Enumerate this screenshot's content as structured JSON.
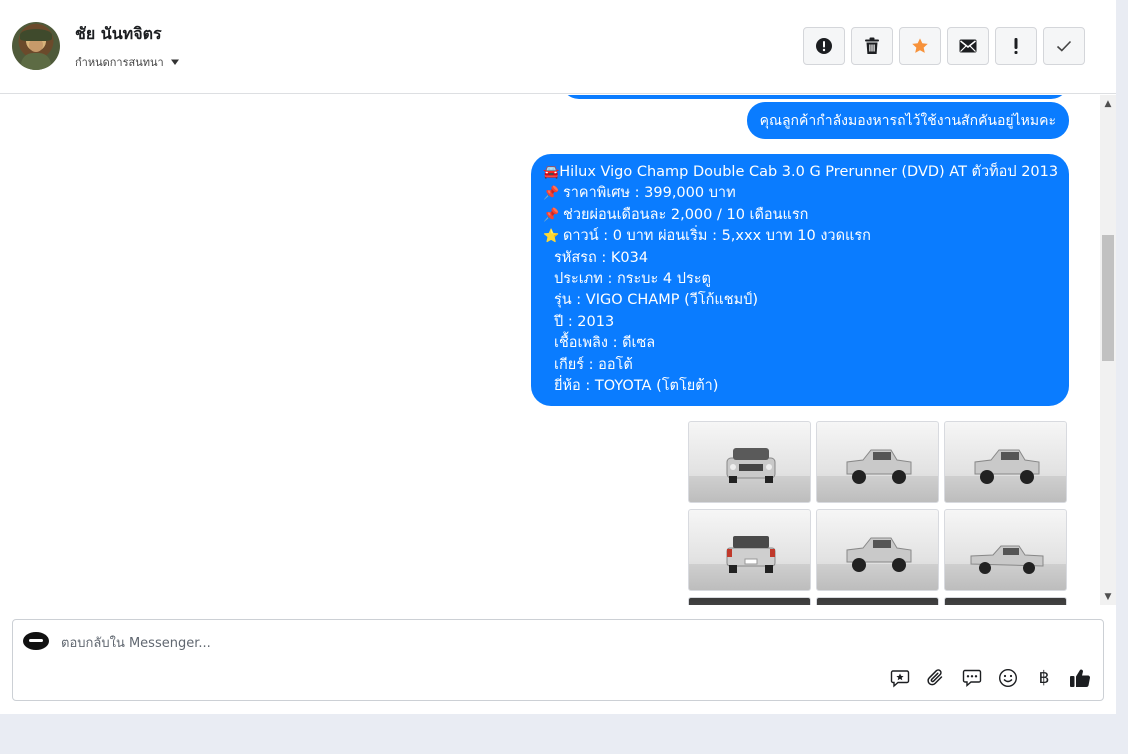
{
  "header": {
    "contact_name": "ชัย นันทจิตร",
    "assign_label": "กำหนดการสนทนา",
    "actions": [
      {
        "name": "spam-button",
        "icon": "alert-circle-icon"
      },
      {
        "name": "delete-button",
        "icon": "trash-icon"
      },
      {
        "name": "star-button",
        "icon": "star-icon",
        "color": "#f7923b"
      },
      {
        "name": "mark-unread-button",
        "icon": "envelope-icon"
      },
      {
        "name": "follow-up-button",
        "icon": "exclamation-icon"
      },
      {
        "name": "mark-done-button",
        "icon": "check-icon"
      }
    ]
  },
  "conversation": {
    "bubble_color": "#0a7cff",
    "question": "คุณลูกค้ากำลังมองหารถไว้ใช้งานสักคันอยู่ไหมคะ",
    "details": [
      {
        "emoji": "🚘",
        "text": "Hilux Vigo Champ Double Cab 3.0 G Prerunner (DVD) AT ตัวท็อป  2013"
      },
      {
        "emoji": "📌",
        "text": "ราคาพิเศษ : 399,000 บาท"
      },
      {
        "emoji": "📌",
        "text": "ช่วยผ่อนเดือนละ 2,000 / 10 เดือนแรก"
      },
      {
        "emoji": "⭐",
        "text": "ดาวน์ : 0 บาท ผ่อนเริ่ม : 5,xxx บาท 10 งวดแรก"
      },
      {
        "emoji": "",
        "text": "รหัสรถ : K034"
      },
      {
        "emoji": "",
        "text": "ประเภท : กระบะ 4 ประตู"
      },
      {
        "emoji": "",
        "text": "รุ่น : VIGO CHAMP (วีโก้แชมป์)"
      },
      {
        "emoji": "",
        "text": "ปี : 2013"
      },
      {
        "emoji": "",
        "text": "เชื้อเพลิง : ดีเซล"
      },
      {
        "emoji": "",
        "text": "เกียร์ : ออโต้"
      },
      {
        "emoji": "",
        "text": "ยี่ห้อ : TOYOTA (โตโยต้า)"
      }
    ],
    "photos": [
      {
        "view": "front"
      },
      {
        "view": "front-left"
      },
      {
        "view": "rear-right"
      },
      {
        "view": "rear"
      },
      {
        "view": "rear-left"
      },
      {
        "view": "side"
      },
      {
        "view": "interior"
      },
      {
        "view": "interior"
      },
      {
        "view": "interior"
      }
    ]
  },
  "reply": {
    "placeholder": "ตอบกลับใน Messenger...",
    "tools": [
      "saved-reply-icon",
      "attachment-icon",
      "message-template-icon",
      "emoji-icon",
      "baht-payment-icon",
      "thumbs-up-icon"
    ],
    "baht_symbol": "฿"
  }
}
